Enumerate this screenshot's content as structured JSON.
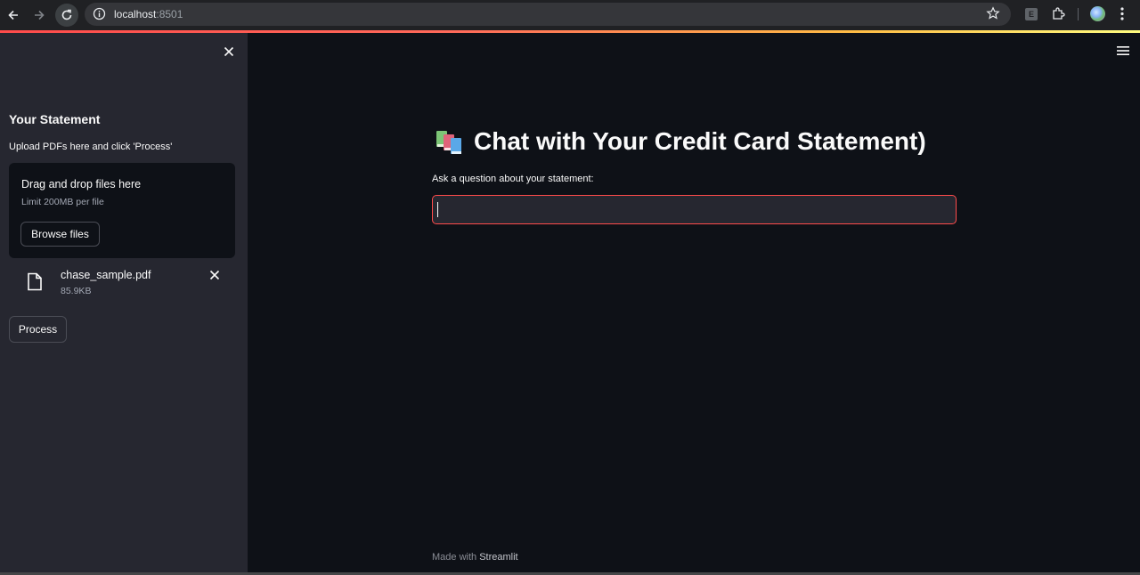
{
  "browser": {
    "url_host": "localhost",
    "url_port": ":8501"
  },
  "sidebar": {
    "title": "Your Statement",
    "hint": "Upload PDFs here and click 'Process'",
    "uploader": {
      "drop_text": "Drag and drop files here",
      "limit_text": "Limit 200MB per file",
      "browse_label": "Browse files"
    },
    "files": [
      {
        "name": "chase_sample.pdf",
        "size": "85.9KB"
      }
    ],
    "process_label": "Process"
  },
  "main": {
    "title_emoji": "books-icon",
    "title": "Chat with Your Credit Card Statement)",
    "question_label": "Ask a question about your statement:",
    "question_value": ""
  },
  "footer": {
    "prefix": "Made with ",
    "brand": "Streamlit"
  },
  "colors": {
    "accent": "#ff4b4b",
    "background": "#0e1117",
    "sidebar": "#262730",
    "text": "#fafafa"
  }
}
